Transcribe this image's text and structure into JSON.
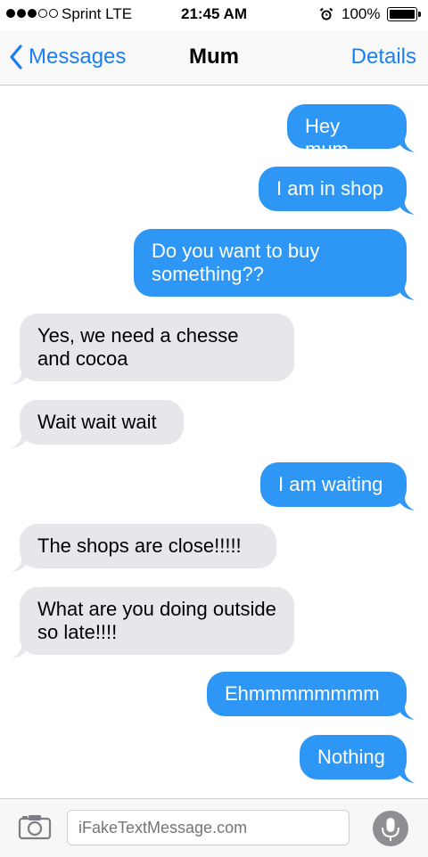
{
  "status_bar": {
    "carrier": "Sprint  LTE",
    "time": "21:45 AM",
    "battery": "100%",
    "signal_bars_filled": 3,
    "signal_bars_total": 5
  },
  "nav": {
    "back_label": "Messages",
    "title": "Mum",
    "details_label": "Details"
  },
  "messages": [
    {
      "text": "Hey mum",
      "direction": "outgoing"
    },
    {
      "text": "I am in shop",
      "direction": "outgoing"
    },
    {
      "text": "Do you want to buy something??",
      "direction": "outgoing"
    },
    {
      "text": "Yes, we need a chesse and cocoa",
      "direction": "incoming"
    },
    {
      "text": "Wait wait wait",
      "direction": "incoming"
    },
    {
      "text": "I am waiting",
      "direction": "outgoing"
    },
    {
      "text": "The shops are close!!!!!",
      "direction": "incoming"
    },
    {
      "text": "What are you doing outside so late!!!!",
      "direction": "incoming"
    },
    {
      "text": "Ehmmmmmmmm",
      "direction": "outgoing"
    },
    {
      "text": "Nothing",
      "direction": "outgoing"
    }
  ],
  "compose": {
    "placeholder": "iFakeTextMessage.com"
  },
  "colors": {
    "accent": "#1b7ff3",
    "outgoing_bubble": "#2e97f5",
    "incoming_bubble": "#e6e6eb"
  },
  "icons": {
    "camera": "camera-icon",
    "mic": "microphone-icon",
    "back": "chevron-left-icon",
    "alarm": "alarm-clock-icon"
  }
}
